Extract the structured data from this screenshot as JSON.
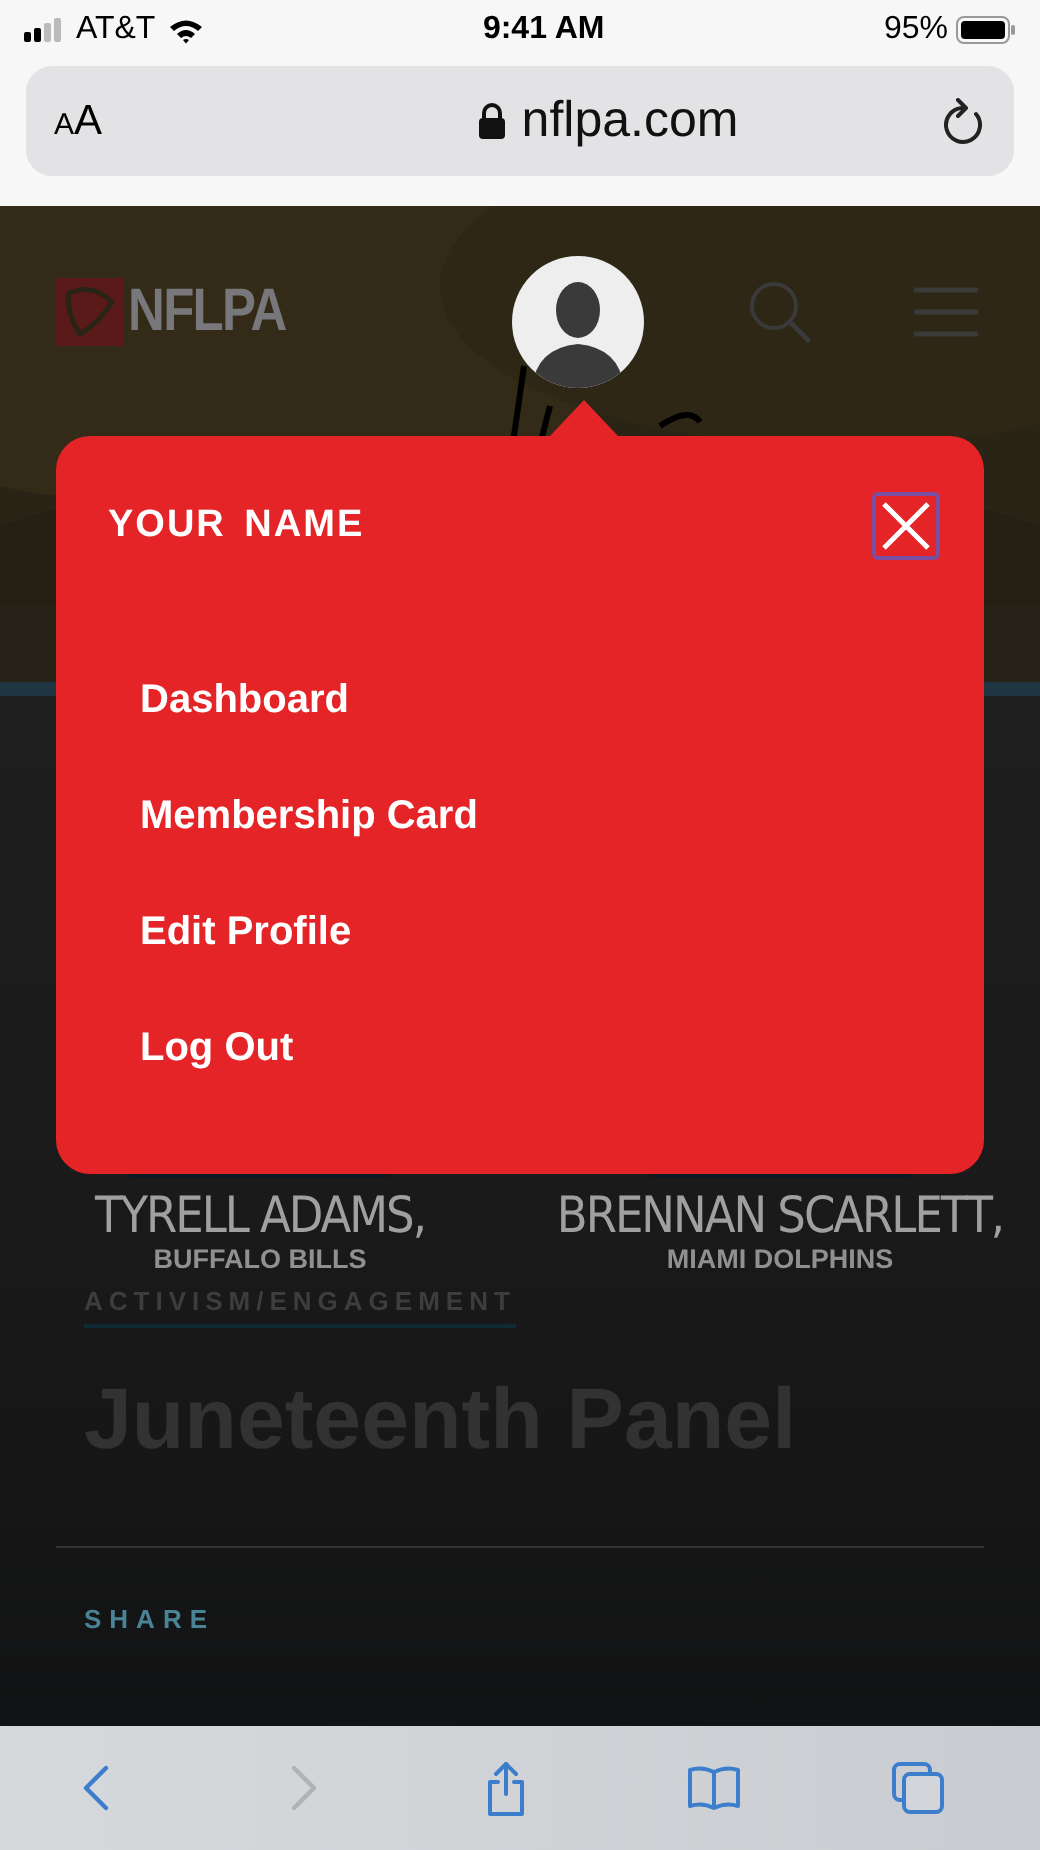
{
  "status_bar": {
    "carrier": "AT&T",
    "time": "9:41 AM",
    "battery": "95%"
  },
  "address_bar": {
    "text_size": "AA",
    "url": "nflpa.com"
  },
  "site_header": {
    "logo": "NFLPA"
  },
  "banner": {
    "people": [
      {
        "name": "TYRELL ADAMS,",
        "team": "BUFFALO BILLS"
      },
      {
        "name": "BRENNAN SCARLETT,",
        "team": "MIAMI DOLPHINS"
      }
    ]
  },
  "article": {
    "category": "ACTIVISM/ENGAGEMENT",
    "title": "Juneteenth Panel",
    "share": "SHARE"
  },
  "menu": {
    "title": "YOUR NAME",
    "items": [
      "Dashboard",
      "Membership Card",
      "Edit Profile",
      "Log Out"
    ]
  },
  "toolbar": [
    {
      "kind": "back",
      "disabled": false
    },
    {
      "kind": "forward",
      "disabled": true
    },
    {
      "kind": "share",
      "disabled": false
    },
    {
      "kind": "bookmarks",
      "disabled": false
    },
    {
      "kind": "tabs",
      "disabled": false
    }
  ]
}
